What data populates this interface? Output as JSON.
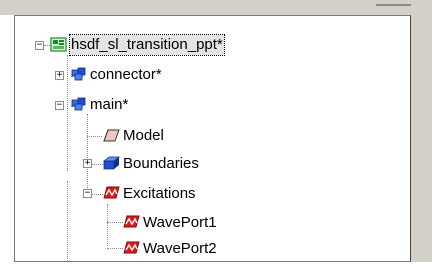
{
  "tree": {
    "root": {
      "label": "hsdf_sl_transition_ppt*",
      "icon": "project-icon",
      "expanded": true,
      "selected": true
    },
    "items": [
      {
        "label": "connector*",
        "icon": "design-icon",
        "expandable": true,
        "expanded": false
      },
      {
        "label": "main*",
        "icon": "design-icon",
        "expandable": true,
        "expanded": true
      },
      {
        "label": "Model",
        "icon": "model-icon",
        "expandable": false
      },
      {
        "label": "Boundaries",
        "icon": "boundaries-icon",
        "expandable": true,
        "expanded": false
      },
      {
        "label": "Excitations",
        "icon": "excitations-icon",
        "expandable": true,
        "expanded": true
      },
      {
        "label": "WavePort1",
        "icon": "waveport-icon",
        "expandable": false
      },
      {
        "label": "WavePort2",
        "icon": "waveport-icon",
        "expandable": false
      }
    ]
  },
  "colors": {
    "design_blue": "#1f4fd0",
    "excitation_red": "#e01818",
    "project_green": "#1a8a2a"
  }
}
